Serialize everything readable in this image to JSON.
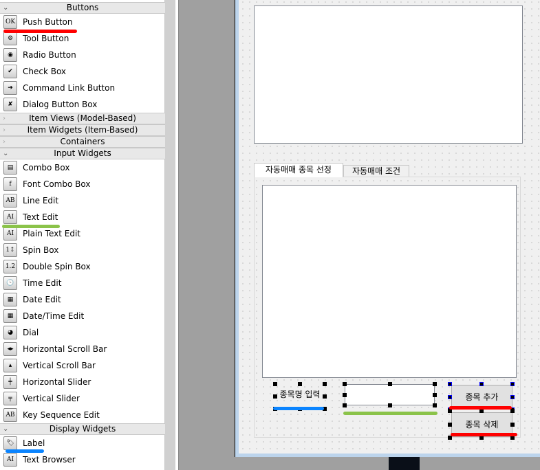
{
  "sidebar": {
    "sections": [
      {
        "label": "Buttons",
        "expanded": true,
        "items": [
          {
            "label": "Push Button",
            "icon": "push-button-icon",
            "glyph": "OK"
          },
          {
            "label": "Tool Button",
            "icon": "tool-button-icon",
            "glyph": "⚙"
          },
          {
            "label": "Radio Button",
            "icon": "radio-button-icon",
            "glyph": "◉"
          },
          {
            "label": "Check Box",
            "icon": "check-box-icon",
            "glyph": "✔"
          },
          {
            "label": "Command Link Button",
            "icon": "command-link-icon",
            "glyph": "➔"
          },
          {
            "label": "Dialog Button Box",
            "icon": "dialog-button-box-icon",
            "glyph": "✘"
          }
        ]
      },
      {
        "label": "Item Views (Model-Based)",
        "expanded": false,
        "items": []
      },
      {
        "label": "Item Widgets (Item-Based)",
        "expanded": false,
        "items": []
      },
      {
        "label": "Containers",
        "expanded": false,
        "items": []
      },
      {
        "label": "Input Widgets",
        "expanded": true,
        "items": [
          {
            "label": "Combo Box",
            "icon": "combo-box-icon",
            "glyph": "▤"
          },
          {
            "label": "Font Combo Box",
            "icon": "font-combo-box-icon",
            "glyph": "f"
          },
          {
            "label": "Line Edit",
            "icon": "line-edit-icon",
            "glyph": "AB"
          },
          {
            "label": "Text Edit",
            "icon": "text-edit-icon",
            "glyph": "AI"
          },
          {
            "label": "Plain Text Edit",
            "icon": "plain-text-edit-icon",
            "glyph": "AI"
          },
          {
            "label": "Spin Box",
            "icon": "spin-box-icon",
            "glyph": "1↕"
          },
          {
            "label": "Double Spin Box",
            "icon": "double-spin-box-icon",
            "glyph": "1.2"
          },
          {
            "label": "Time Edit",
            "icon": "clock-icon",
            "glyph": "🕓"
          },
          {
            "label": "Date Edit",
            "icon": "calendar-icon",
            "glyph": "▦"
          },
          {
            "label": "Date/Time Edit",
            "icon": "calendar-clock-icon",
            "glyph": "▦"
          },
          {
            "label": "Dial",
            "icon": "dial-icon",
            "glyph": "◕"
          },
          {
            "label": "Horizontal Scroll Bar",
            "icon": "horizontal-scroll-bar-icon",
            "glyph": "◂▸"
          },
          {
            "label": "Vertical Scroll Bar",
            "icon": "vertical-scroll-bar-icon",
            "glyph": "▴"
          },
          {
            "label": "Horizontal Slider",
            "icon": "horizontal-slider-icon",
            "glyph": "┿"
          },
          {
            "label": "Vertical Slider",
            "icon": "vertical-slider-icon",
            "glyph": "╤"
          },
          {
            "label": "Key Sequence Edit",
            "icon": "key-sequence-edit-icon",
            "glyph": "AB"
          }
        ]
      },
      {
        "label": "Display Widgets",
        "expanded": true,
        "items": [
          {
            "label": "Label",
            "icon": "label-tag-icon",
            "glyph": "🏷"
          },
          {
            "label": "Text Browser",
            "icon": "text-browser-icon",
            "glyph": "AI"
          }
        ]
      }
    ]
  },
  "form": {
    "tabs": [
      {
        "label": "자동매매 종목 선정",
        "active": true
      },
      {
        "label": "자동매매 조건",
        "active": false
      }
    ],
    "label_text": "종목명 입력",
    "line_edit_value": "",
    "add_button": "종목 추가",
    "delete_button": "종목 삭제"
  },
  "colors": {
    "red_mark": "#ff0000",
    "green_mark": "#8bc34a",
    "blue_mark": "#0a84ff",
    "form_border": "#bcd4ec"
  }
}
